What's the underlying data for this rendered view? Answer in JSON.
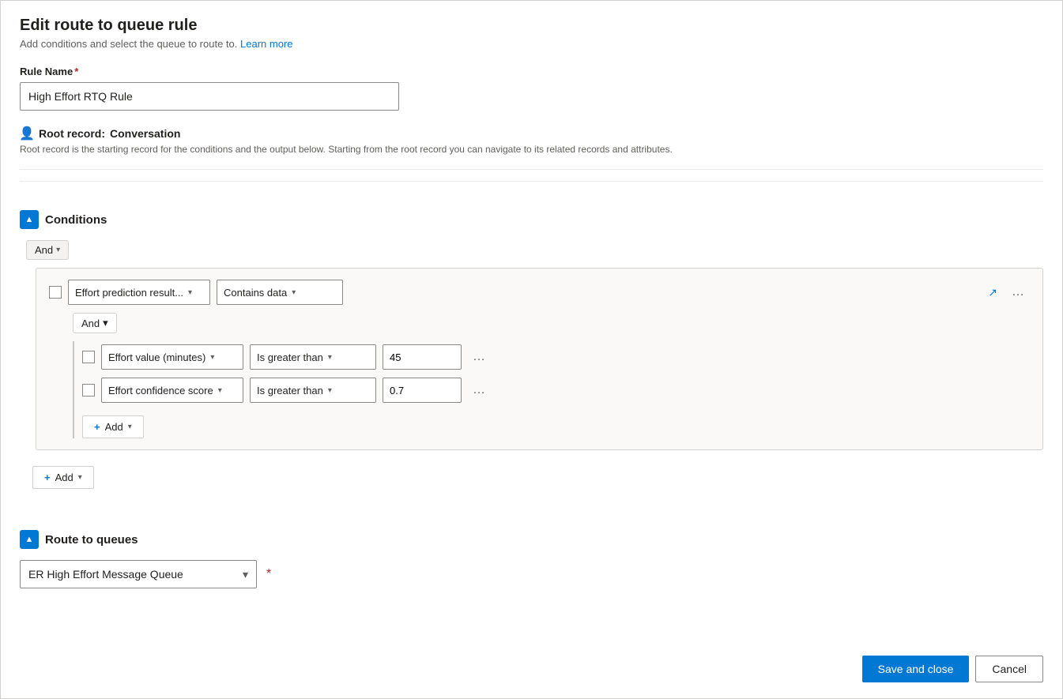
{
  "page": {
    "title": "Edit route to queue rule",
    "subtitle": "Add conditions and select the queue to route to.",
    "learn_more_label": "Learn more"
  },
  "rule_name": {
    "label": "Rule Name",
    "required_marker": "*",
    "value": "High Effort RTQ Rule"
  },
  "root_record": {
    "label": "Root record:",
    "value": "Conversation",
    "description": "Root record is the starting record for the conditions and the output below. Starting from the root record you can navigate to its related records and attributes."
  },
  "conditions_section": {
    "title": "Conditions",
    "and_label": "And",
    "and_inner_label": "And",
    "condition1": {
      "field": "Effort prediction result...",
      "operator": "Contains data"
    },
    "condition2": {
      "field": "Effort value (minutes)",
      "operator": "Is greater than",
      "value": "45"
    },
    "condition3": {
      "field": "Effort confidence score",
      "operator": "Is greater than",
      "value": "0.7"
    },
    "add_label": "+ Add",
    "add_outer_label": "+ Add"
  },
  "route_section": {
    "title": "Route to queues",
    "queue_label": "ER High Effort Message Queue",
    "required_marker": "*"
  },
  "footer": {
    "save_close_label": "Save and close",
    "cancel_label": "Cancel"
  }
}
